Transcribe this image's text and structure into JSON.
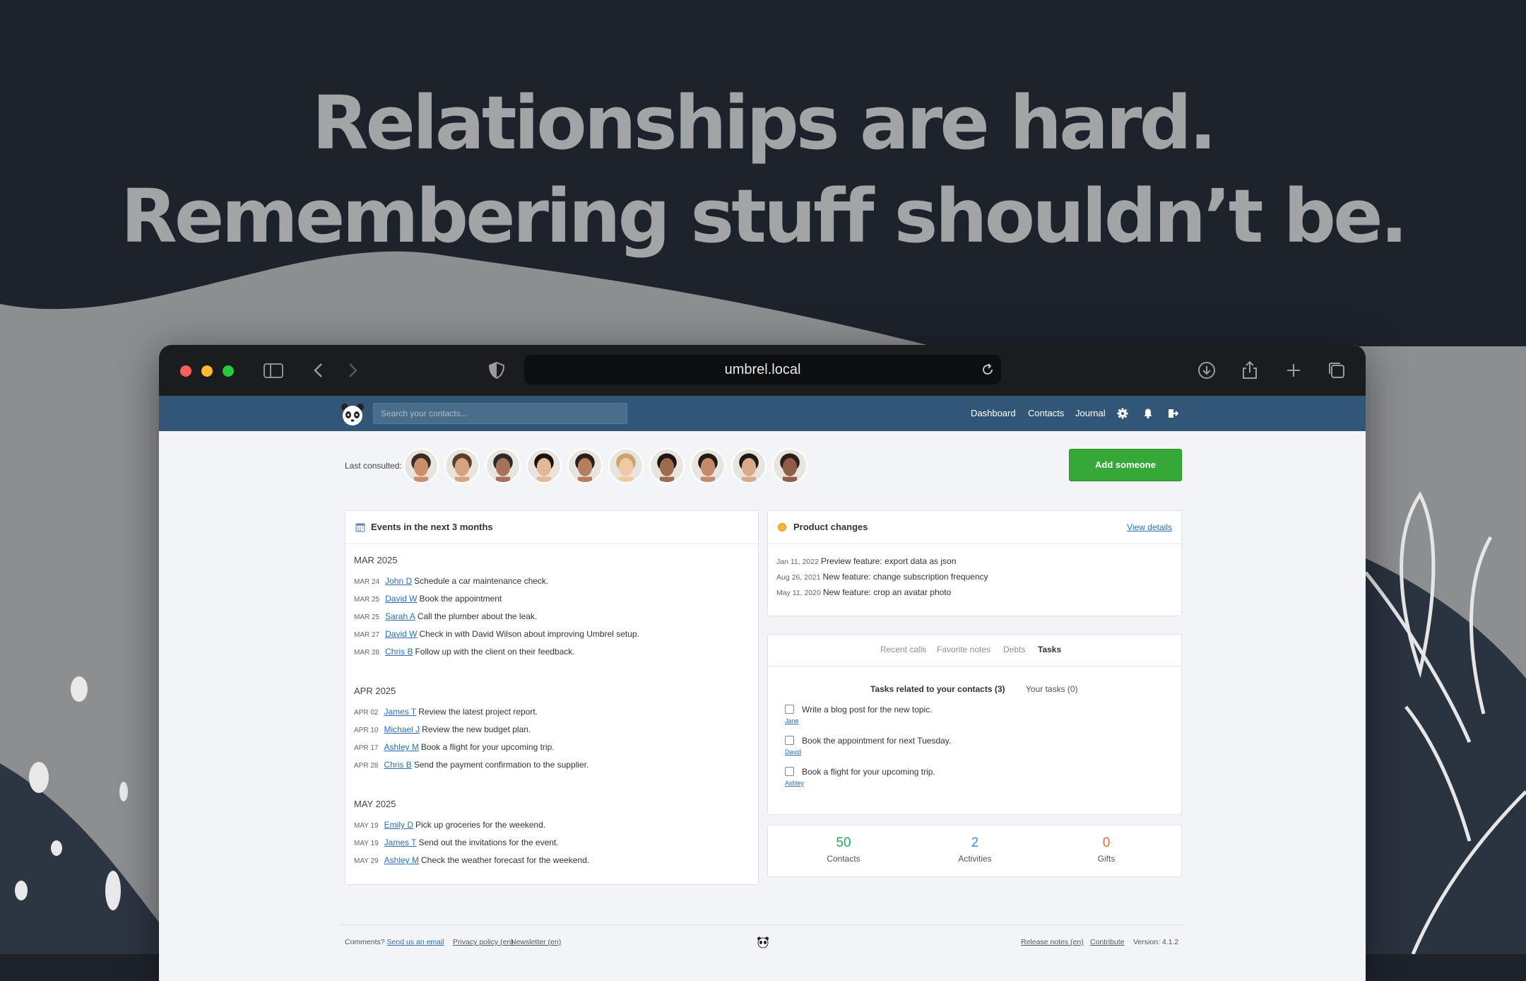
{
  "headline": {
    "line1": "Relationships are hard.",
    "line2": "Remembering stuff shouldn’t be."
  },
  "browser": {
    "url": "umbrel.local",
    "icons": [
      "sidebar-icon",
      "back-icon",
      "forward-icon",
      "shield-icon",
      "reload-icon",
      "download-icon",
      "share-icon",
      "new-tab-icon",
      "tabs-overview-icon"
    ]
  },
  "navbar": {
    "search_placeholder": "Search your contacts...",
    "links": [
      "Dashboard",
      "Contacts",
      "Journal"
    ],
    "icons": [
      "settings-icon",
      "bell-icon",
      "logout-icon"
    ]
  },
  "last_consulted": {
    "label": "Last consulted:",
    "avatar_count": 10
  },
  "add_button": "Add someone",
  "events": {
    "title": "Events in the next 3 months",
    "months": [
      {
        "name": "MAR 2025",
        "items": [
          {
            "date": "MAR 24",
            "contact": "John D",
            "text": "Schedule a car maintenance check."
          },
          {
            "date": "MAR 25",
            "contact": "David W",
            "text": "Book the appointment"
          },
          {
            "date": "MAR 25",
            "contact": "Sarah A",
            "text": "Call the plumber about the leak."
          },
          {
            "date": "MAR 27",
            "contact": "David W",
            "text": "Check in with David Wilson about improving Umbrel setup."
          },
          {
            "date": "MAR 28",
            "contact": "Chris B",
            "text": "Follow up with the client on their feedback."
          }
        ]
      },
      {
        "name": "APR 2025",
        "items": [
          {
            "date": "APR 02",
            "contact": "James T",
            "text": "Review the latest project report."
          },
          {
            "date": "APR 10",
            "contact": "Michael J",
            "text": "Review the new budget plan."
          },
          {
            "date": "APR 17",
            "contact": "Ashley M",
            "text": "Book a flight for your upcoming trip."
          },
          {
            "date": "APR 28",
            "contact": "Chris B",
            "text": "Send the payment confirmation to the supplier."
          }
        ]
      },
      {
        "name": "MAY 2025",
        "items": [
          {
            "date": "MAY 19",
            "contact": "Emily D",
            "text": "Pick up groceries for the weekend."
          },
          {
            "date": "MAY 19",
            "contact": "James T",
            "text": "Send out the invitations for the event."
          },
          {
            "date": "MAY 29",
            "contact": "Ashley M",
            "text": "Check the weather forecast for the weekend."
          }
        ]
      }
    ]
  },
  "product_changes": {
    "title": "Product changes",
    "view_details": "View details",
    "items": [
      {
        "date": "Jan 11, 2022",
        "text": "Preview feature: export data as json"
      },
      {
        "date": "Aug 26, 2021",
        "text": "New feature: change subscription frequency"
      },
      {
        "date": "May 11, 2020",
        "text": "New feature: crop an avatar photo"
      }
    ]
  },
  "tabs": {
    "items": [
      "Recent calls",
      "Favorite notes",
      "Debts",
      "Tasks"
    ],
    "active": "Tasks",
    "subtab_related": "Tasks related to your contacts (3)",
    "subtab_yours": "Your tasks (0)",
    "tasks": [
      {
        "text": "Write a blog post for the new topic.",
        "contact": "Jane"
      },
      {
        "text": "Book the appointment for next Tuesday.",
        "contact": "David"
      },
      {
        "text": "Book a flight for your upcoming trip.",
        "contact": "Ashley"
      }
    ]
  },
  "stats": [
    {
      "value": "50",
      "label": "Contacts",
      "color": "#2fa360"
    },
    {
      "value": "2",
      "label": "Activities",
      "color": "#3d8fd1"
    },
    {
      "value": "0",
      "label": "Gifts",
      "color": "#f0673a"
    }
  ],
  "footer": {
    "comments": "Comments?",
    "email": "Send us an email",
    "privacy": "Privacy policy (en)",
    "newsletter": "Newsletter (en)",
    "release_notes": "Release notes (en)",
    "contribute": "Contribute",
    "version": "Version: 4.1.2"
  }
}
